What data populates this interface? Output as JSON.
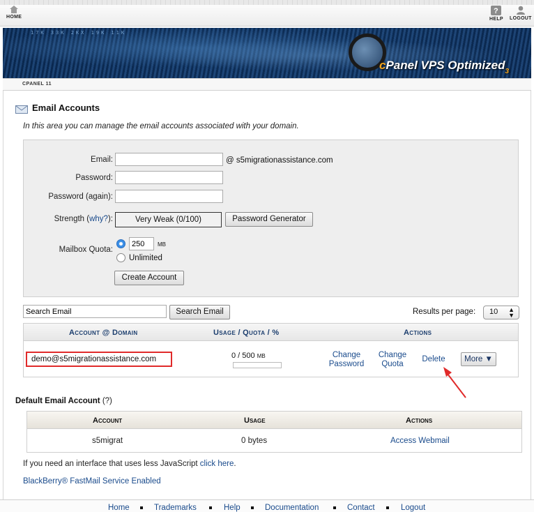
{
  "topnav": {
    "home": "HOME",
    "help": "HELP",
    "logout": "LOGOUT"
  },
  "banner": {
    "brand_c": "c",
    "brand_rest": "Panel VPS Optimized",
    "brand_sub": "3",
    "ticker": "17K   33K   2KX   19K   11K"
  },
  "version": "CPANEL 11",
  "page": {
    "title": "Email Accounts",
    "intro": "In this area you can manage the email accounts associated with your domain."
  },
  "form": {
    "email_label": "Email:",
    "email_value": "",
    "domain_suffix": "@ s5migrationassistance.com",
    "password_label": "Password:",
    "password_again_label": "Password (again):",
    "strength_label": "Strength",
    "why_link": "why?",
    "strength_colon": "):",
    "strength_value": "Very Weak (0/100)",
    "password_generator": "Password Generator",
    "quota_label": "Mailbox Quota:",
    "quota_value": "250",
    "quota_unit": "MB",
    "unlimited_label": "Unlimited",
    "create_button": "Create Account"
  },
  "search": {
    "placeholder": "Search Email",
    "button": "Search Email",
    "results_label": "Results per page:",
    "results_value": "10"
  },
  "accounts_table": {
    "headers": {
      "account": "Account @ Domain",
      "usage": "Usage / Quota / %",
      "actions": "Actions"
    },
    "rows": [
      {
        "email": "demo@s5migrationassistance.com",
        "usage": "0 / 500",
        "usage_unit": "MB",
        "usage_fraction": 0,
        "change_password": [
          "Change",
          "Password"
        ],
        "change_quota": [
          "Change",
          "Quota"
        ],
        "delete": "Delete",
        "more": "More ▼"
      }
    ]
  },
  "default_account": {
    "title": "Default Email Account",
    "help": "(?)",
    "headers": {
      "account": "Account",
      "usage": "Usage",
      "actions": "Actions"
    },
    "row": {
      "account": "s5migrat",
      "usage": "0 bytes",
      "action": "Access Webmail"
    }
  },
  "note": {
    "text": "If you need an interface that uses less JavaScript ",
    "link": "click here",
    "end": "."
  },
  "blackberry": "BlackBerry® FastMail Service Enabled",
  "footer": [
    "Home",
    "Trademarks",
    "Help",
    "Documentation",
    "Contact",
    "Logout"
  ],
  "colors": {
    "highlight_border": "#e02a2a",
    "arrow": "#e02a2a",
    "link": "#1a4b8c"
  }
}
